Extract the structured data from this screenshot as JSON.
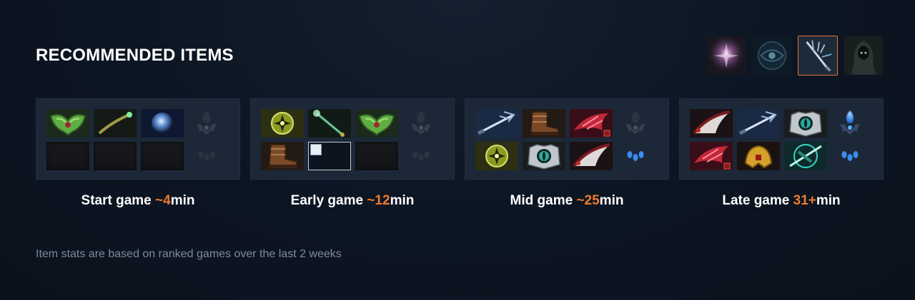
{
  "section": {
    "title": "RECOMMENDED ITEMS"
  },
  "heroes": [
    {
      "name": "hero-1",
      "icon": "hero-portrait-pink-spark-icon",
      "selected": false
    },
    {
      "name": "hero-2",
      "icon": "hero-portrait-dark-orb-icon",
      "selected": false
    },
    {
      "name": "hero-3",
      "icon": "hero-portrait-trident-icon",
      "selected": true
    },
    {
      "name": "hero-4",
      "icon": "hero-portrait-hooded-figure-icon",
      "selected": false
    }
  ],
  "builds": [
    {
      "caption_prefix": "Start game ",
      "caption_time": "~4",
      "caption_suffix": "min",
      "items": [
        "green-mask-icon",
        "magic-wand-icon",
        "blue-orb-icon",
        "empty",
        "empty",
        "empty"
      ],
      "neutral": [
        "neutral-tier-dark-icon",
        "neutral-token-dark-icon"
      ]
    },
    {
      "caption_prefix": "Early game ",
      "caption_time": "~12",
      "caption_suffix": "min",
      "items": [
        "yellow-sigil-icon",
        "jade-staff-icon",
        "green-mask-icon",
        "leather-boots-icon",
        "broken-image",
        "empty"
      ],
      "neutral": [
        "neutral-tier-dark-icon",
        "neutral-token-dark-icon"
      ]
    },
    {
      "caption_prefix": "Mid game ",
      "caption_time": "~25",
      "caption_suffix": "min",
      "items": [
        "trident-icon",
        "leather-boots-icon",
        "red-claw-icon",
        "yellow-sigil-icon",
        "eye-orb-icon",
        "dark-blade-icon"
      ],
      "neutral": [
        "neutral-tier-dark-icon",
        "neutral-token-blue-icon"
      ]
    },
    {
      "caption_prefix": "Late game ",
      "caption_time": "31+",
      "caption_suffix": "min",
      "items": [
        "dark-blade-icon",
        "trident-icon",
        "eye-orb-icon",
        "red-claw-icon",
        "gold-helm-icon",
        "teal-sword-icon"
      ],
      "neutral": [
        "neutral-tier-blue-icon",
        "neutral-token-blue-icon"
      ]
    }
  ],
  "footer": {
    "note": "Item stats are based on ranked games over the last 2 weeks"
  },
  "colors": {
    "accent": "#f07a2c",
    "panel": "#1c2838",
    "background": "#0c1522"
  }
}
